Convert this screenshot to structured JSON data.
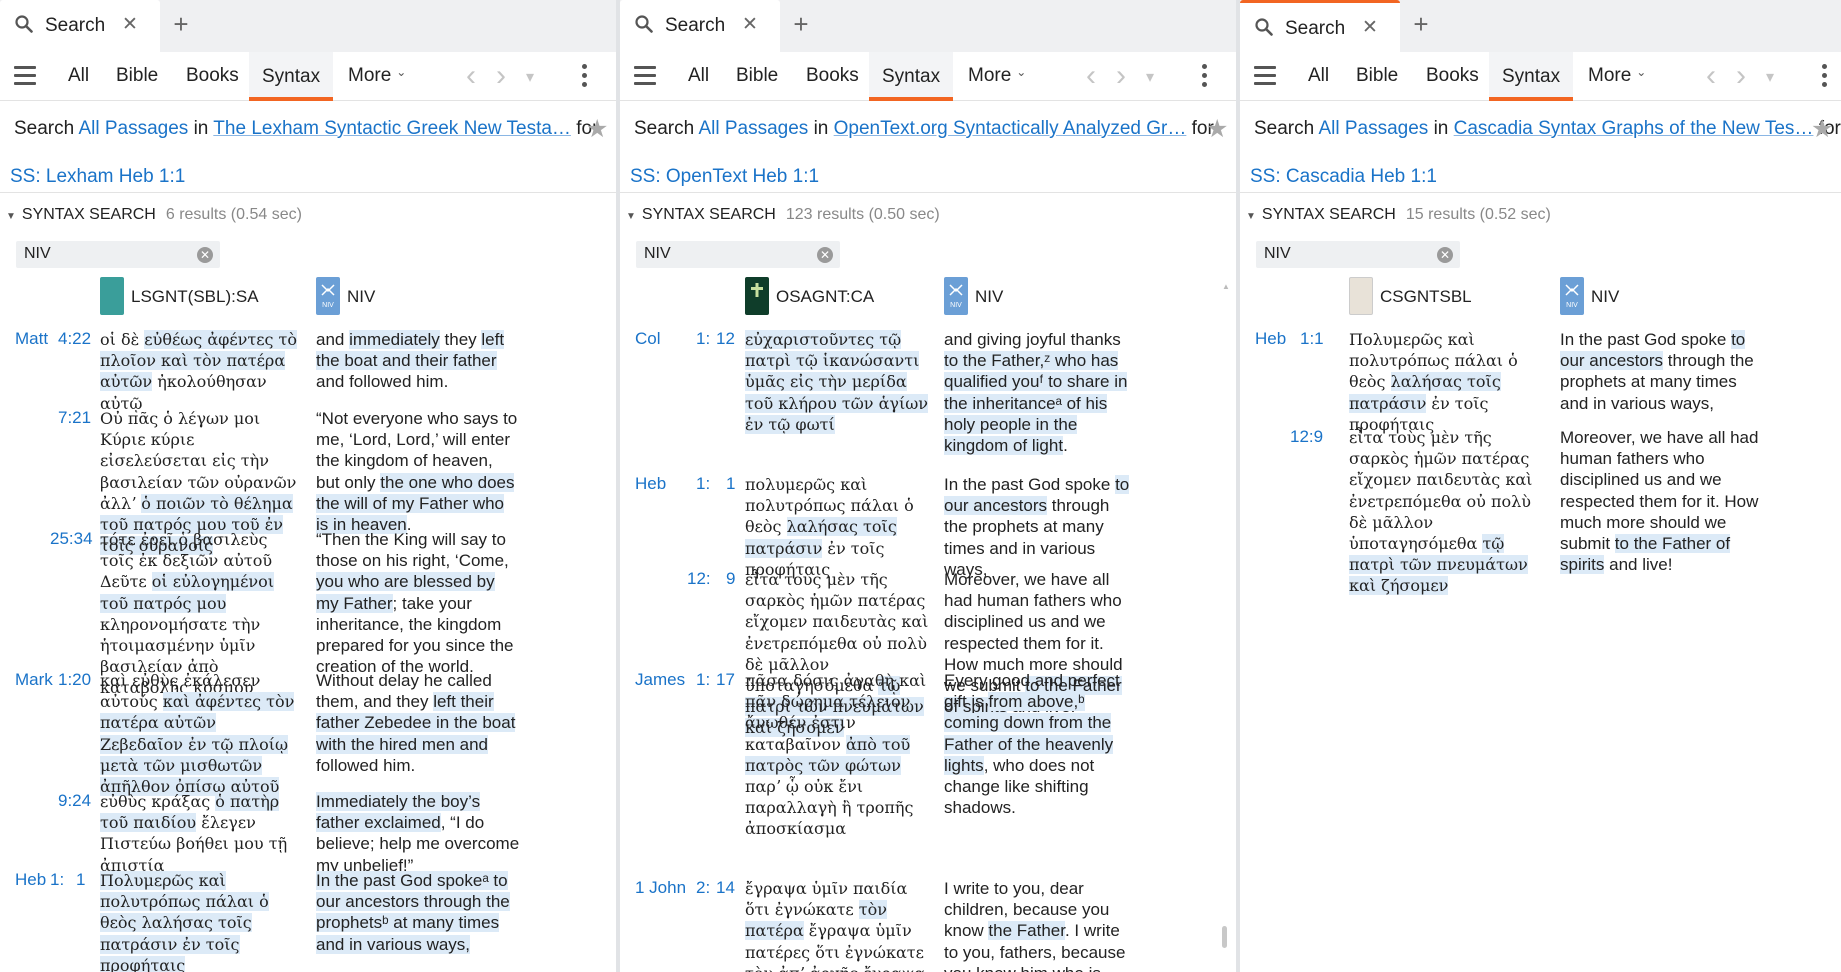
{
  "panels": [
    {
      "tab": {
        "label": "Search",
        "close": "✕",
        "new": "+"
      },
      "toolbar": {
        "items": [
          "All",
          "Bible",
          "Books",
          "Syntax"
        ],
        "more": "More"
      },
      "search_line": {
        "prefix": "Search",
        "scope": "All Passages",
        "mid": "in",
        "resource": "The Lexham Syntactic Greek New Testa…",
        "suffix": "for"
      },
      "query": "SS: Lexham Heb 1:1",
      "section": {
        "title": "SYNTAX SEARCH",
        "results": "6 results (0.54 sec)"
      },
      "filter": "NIV",
      "columns": {
        "left": "LSGNT(SBL):SA",
        "right": "NIV",
        "left_icon": "book-cover-teal-icon",
        "right_icon": "niv-cover-icon"
      },
      "rows": [
        {
          "book": "Matt",
          "ch": "4:22",
          "v": "",
          "greek": "οἱ δὲ εὐθέως ἀφέντες τὸ πλοῖον καὶ τὸν πατέρα αὐτῶν ἠκολούθησαν αὐτῷ",
          "english": "and immediately they left the boat and their father and followed him."
        },
        {
          "book": "",
          "ch": "7:21",
          "v": "",
          "greek": "Οὐ πᾶς ὁ λέγων μοι Κύριε κύριε εἰσελεύσεται εἰς τὴν βασιλείαν τῶν οὐρανῶν ἀλλʼ ὁ ποιῶν τὸ θέλημα τοῦ πατρός μου τοῦ ἐν τοῖς οὐρανοῖς",
          "english": "“Not everyone who says to me, ‘Lord, Lord,’ will enter the kingdom of heaven, but only the one who does the will of my Father who is in heaven."
        },
        {
          "book": "",
          "ch": "25:34",
          "v": "",
          "greek": "τότε ἐρεῖ ὁ βασιλεὺς τοῖς ἐκ δεξιῶν αὐτοῦ Δεῦτε οἱ εὐλογημένοι τοῦ πατρός μου κληρονομήσατε τὴν ἡτοιμασμένην ὑμῖν βασιλείαν ἀπὸ καταβολῆς κόσμου",
          "english": "“Then the King will say to those on his right, ‘Come, you who are blessed by my Father; take your inheritance, the kingdom prepared for you since the creation of the world."
        },
        {
          "book": "Mark",
          "ch": "1:20",
          "v": "",
          "greek": "καὶ εὐθὺς ἐκάλεσεν αὐτούς καὶ ἀφέντες τὸν πατέρα αὐτῶν Ζεβεδαῖον ἐν τῷ πλοίῳ μετὰ τῶν μισθωτῶν ἀπῆλθον ὀπίσω αὐτοῦ",
          "english": "Without delay he called them, and they left their father Zebedee in the boat with the hired men and followed him."
        },
        {
          "book": "",
          "ch": "9:24",
          "v": "",
          "greek": "εὐθὺς κράξας ὁ πατὴρ τοῦ παιδίου ἔλεγεν Πιστεύω βοήθει μου τῇ ἀπιστίᾳ",
          "english": "Immediately the boy’s father exclaimed, “I do believe; help me overcome my unbelief!”"
        },
        {
          "book": "Heb",
          "ch": "1:",
          "v": "1",
          "greek": "Πολυμερῶς καὶ πολυτρόπως πάλαι ὁ θεὸς λαλήσας τοῖς πατράσιν ἐν τοῖς προφήταις",
          "english": "In the past God spokeᵃ to our ancestors through the prophetsᵇ at many times and in various ways,"
        }
      ]
    },
    {
      "tab": {
        "label": "Search",
        "close": "✕",
        "new": "+"
      },
      "toolbar": {
        "items": [
          "All",
          "Bible",
          "Books",
          "Syntax"
        ],
        "more": "More"
      },
      "search_line": {
        "prefix": "Search",
        "scope": "All Passages",
        "mid": "in",
        "resource": "OpenText.org Syntactically Analyzed Gr…",
        "suffix": "for"
      },
      "query": "SS: OpenText Heb 1:1",
      "section": {
        "title": "SYNTAX SEARCH",
        "results": "123 results (0.50 sec)"
      },
      "filter": "NIV",
      "columns": {
        "left": "OSAGNT:CA",
        "right": "NIV",
        "left_icon": "book-cover-cross-icon",
        "right_icon": "niv-cover-icon"
      },
      "rows": [
        {
          "book": "Col",
          "ch": "1:",
          "v": "12",
          "greek": "εὐχαριστοῦντες τῷ πατρὶ τῷ ἱκανώσαντι ὑμᾶς εἰς τὴν μερίδα τοῦ κλήρου τῶν ἁγίων ἐν τῷ φωτί",
          "english": "and giving joyful thanks to the Father,ᶻ who has qualified youᶠ to share in the inheritanceᵃ of his holy people in the kingdom of light."
        },
        {
          "book": "Heb",
          "ch": "1:",
          "v": "1",
          "greek": "πολυμερῶς καὶ πολυτρόπως πάλαι ὁ θεὸς λαλήσας τοῖς πατράσιν ἐν τοῖς προφήταις",
          "english": "In the past God spoke to our ancestors through the prophets at many times and in various ways,"
        },
        {
          "book": "",
          "ch": "12:",
          "v": "9",
          "greek": "εἶτα τοὺς μὲν τῆς σαρκὸς ἡμῶν πατέρας εἴχομεν παιδευτὰς καὶ ἐνετρεπόμεθα οὐ πολὺ δὲ μᾶλλον ὑποταγησόμεθα τῷ πατρὶ τῶν πνευμάτων καὶ ζήσομεν",
          "english": "Moreover, we have all had human fathers who disciplined us and we respected them for it. How much more should we submit to the Father of spirits and live!"
        },
        {
          "book": "James",
          "ch": "1:",
          "v": "17",
          "greek": "πᾶσα δόσις ἀγαθὴ καὶ πᾶν δώρημα τέλειον ἄνωθέν ἐστιν καταβαῖνον ἀπὸ τοῦ πατρὸς τῶν φώτων παρʼ ᾧ οὐκ ἔνι παραλλαγὴ ἢ τροπῆς ἀποσκίασμα",
          "english": "Every good and perfect gift is from above,ᵇ coming down from the Father of the heavenly lights, who does not change like shifting shadows."
        },
        {
          "book": "1 John",
          "ch": "2:",
          "v": "14",
          "greek": "ἔγραψα ὑμῖν παιδία ὅτι ἐγνώκατε τὸν πατέρα ἔγραψα ὑμῖν πατέρες ὅτι ἐγνώκατε τὸν ἀπʼ ἀρχῆς ἔγραψα ὑμῖν νεανίσκοι ὅτι",
          "english": "I write to you, dear children, because you know the Father. I write to you, fathers, because you know him who is from the"
        }
      ]
    },
    {
      "tab": {
        "label": "Search",
        "close": "✕",
        "new": "+"
      },
      "toolbar": {
        "items": [
          "All",
          "Bible",
          "Books",
          "Syntax"
        ],
        "more": "More"
      },
      "search_line": {
        "prefix": "Search",
        "scope": "All Passages",
        "mid": "in",
        "resource": "Cascadia Syntax Graphs of the New Tes…",
        "suffix": "for"
      },
      "query": "SS: Cascadia Heb 1:1",
      "section": {
        "title": "SYNTAX SEARCH",
        "results": "15 results (0.52 sec)"
      },
      "filter": "NIV",
      "columns": {
        "left": "CSGNTSBL",
        "right": "NIV",
        "left_icon": "book-cover-plain-icon",
        "right_icon": "niv-cover-icon"
      },
      "rows": [
        {
          "book": "Heb",
          "ch": "1:1",
          "v": "",
          "greek": "Πολυμερῶς καὶ πολυτρόπως πάλαι ὁ θεὸς λαλήσας τοῖς πατράσιν ἐν τοῖς προφήταις",
          "english": "In the past God spoke to our ancestors through the prophets at many times and in various ways,"
        },
        {
          "book": "",
          "ch": "12:9",
          "v": "",
          "greek": "εἶτα τοὺς μὲν τῆς σαρκὸς ἡμῶν πατέρας εἴχομεν παιδευτὰς καὶ ἐνετρεπόμεθα οὐ πολὺ δὲ μᾶλλον ὑποταγησόμεθα τῷ πατρὶ τῶν πνευμάτων καὶ ζήσομεν",
          "english": "Moreover, we have all had human fathers who disciplined us and we respected them for it. How much more should we submit to the Father of spirits and live!"
        }
      ]
    }
  ],
  "colors": {
    "accent": "#f26522",
    "link": "#1a73c8",
    "highlight": "#dceaf7"
  }
}
